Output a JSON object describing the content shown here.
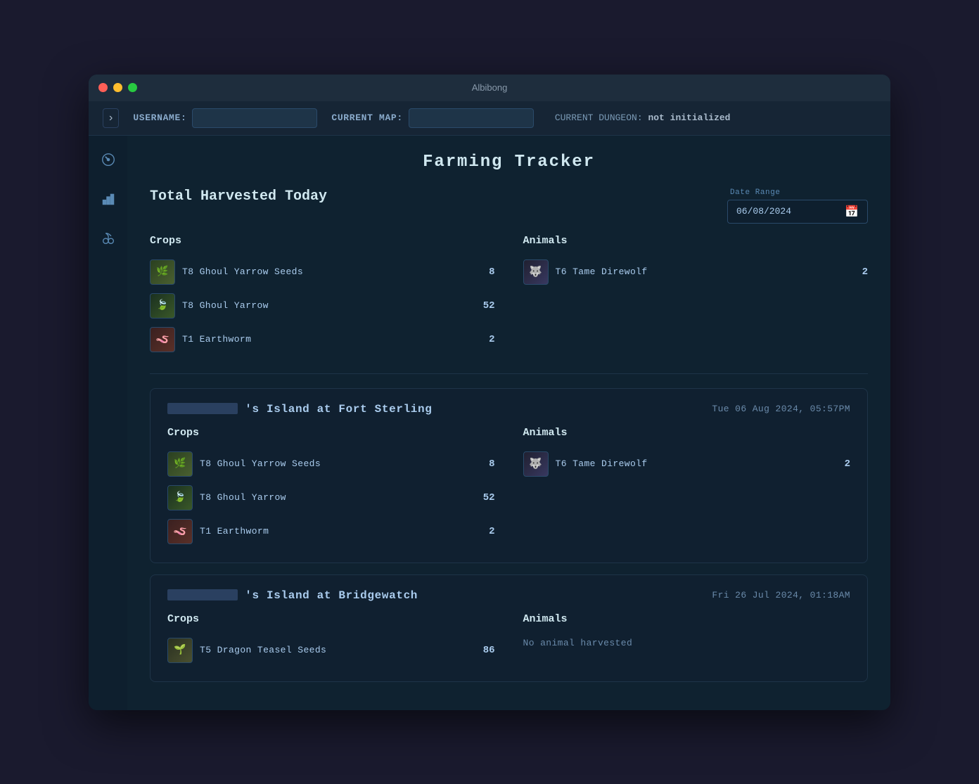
{
  "window": {
    "title": "Albibong"
  },
  "header": {
    "username_label": "USERNAME:",
    "username_value": "",
    "current_map_label": "CURRENT MAP:",
    "current_map_value": "",
    "current_dungeon_label": "CURRENT DUNGEON:",
    "current_dungeon_value": "not initialized",
    "toggle_icon": "›"
  },
  "sidebar": {
    "items": [
      {
        "icon": "gauge",
        "label": "Dashboard"
      },
      {
        "icon": "bar-chart",
        "label": "Stats"
      },
      {
        "icon": "farming",
        "label": "Farming"
      }
    ]
  },
  "main": {
    "page_title": "Farming Tracker",
    "total_harvested": {
      "section_title": "Total Harvested Today",
      "date_range_label": "Date Range",
      "date_range_value": "06/08/2024",
      "crops_title": "Crops",
      "crops": [
        {
          "name": "T8 Ghoul Yarrow Seeds",
          "count": "8",
          "icon_type": "yarrow-seeds"
        },
        {
          "name": "T8 Ghoul Yarrow",
          "count": "52",
          "icon_type": "yarrow"
        },
        {
          "name": "T1 Earthworm",
          "count": "2",
          "icon_type": "earthworm"
        }
      ],
      "animals_title": "Animals",
      "animals": [
        {
          "name": "T6 Tame Direwolf",
          "count": "2",
          "icon_type": "direwolf"
        }
      ]
    },
    "sessions": [
      {
        "title_prefix": "",
        "title_main": "'s Island at Fort Sterling",
        "timestamp": "Tue 06 Aug 2024, 05:57PM",
        "crops_title": "Crops",
        "crops": [
          {
            "name": "T8 Ghoul Yarrow Seeds",
            "count": "8",
            "icon_type": "yarrow-seeds"
          },
          {
            "name": "T8 Ghoul Yarrow",
            "count": "52",
            "icon_type": "yarrow"
          },
          {
            "name": "T1 Earthworm",
            "count": "2",
            "icon_type": "earthworm"
          }
        ],
        "animals_title": "Animals",
        "animals": [
          {
            "name": "T6 Tame Direwolf",
            "count": "2",
            "icon_type": "direwolf"
          }
        ],
        "no_animal_text": null
      },
      {
        "title_prefix": "",
        "title_main": "'s Island at Bridgewatch",
        "timestamp": "Fri 26 Jul 2024, 01:18AM",
        "crops_title": "Crops",
        "crops": [
          {
            "name": "T5 Dragon Teasel Seeds",
            "count": "86",
            "icon_type": "dragon-teasel"
          }
        ],
        "animals_title": "Animals",
        "animals": [],
        "no_animal_text": "No animal harvested"
      }
    ]
  }
}
